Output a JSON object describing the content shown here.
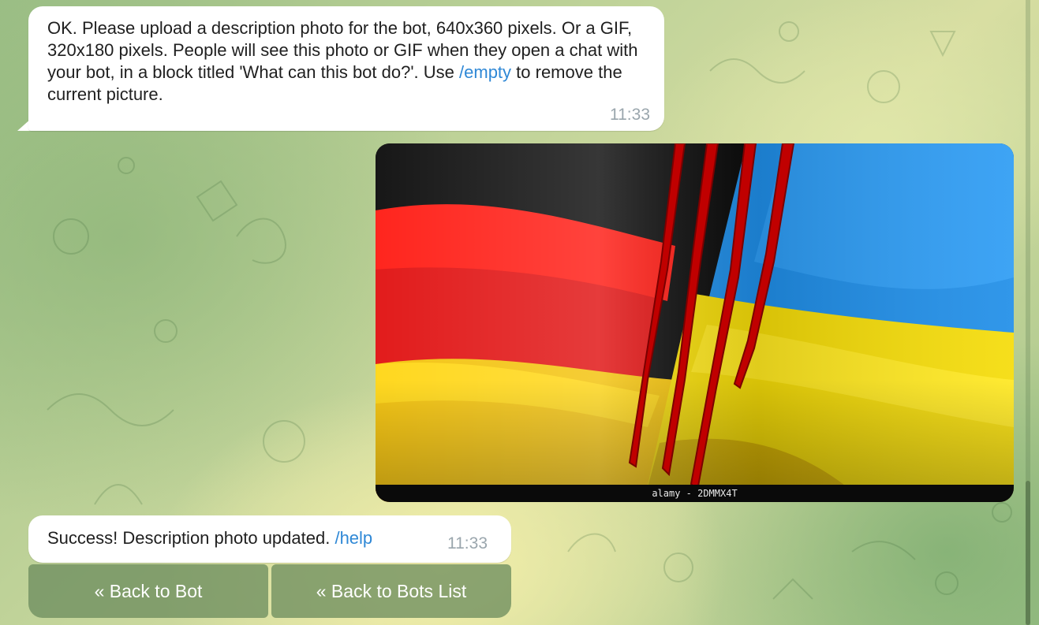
{
  "chat": {
    "messages": [
      {
        "type": "text",
        "direction": "incoming",
        "text_before": "OK. Please upload a description photo for the bot, 640x360 pixels. Or a GIF,  320x180 pixels. People will see this photo or GIF when they open a chat with your bot, in a block titled 'What can this bot do?'. Use ",
        "command": "/empty",
        "text_after": " to remove the current picture.",
        "time": "11:33"
      },
      {
        "type": "photo",
        "direction": "outgoing",
        "image_caption": "alamy - 2DMMX4T",
        "image_subject": "german-and-ukrainian-flags-torn"
      },
      {
        "type": "text",
        "direction": "incoming",
        "text_before": "Success! Description photo updated. ",
        "command": "/help",
        "time": "11:33"
      }
    ],
    "keyboard": [
      {
        "label": "« Back to Bot"
      },
      {
        "label": "« Back to Bots List"
      }
    ]
  },
  "colors": {
    "link": "#2f88d6",
    "bubble": "#ffffff",
    "time": "#9aa6ad",
    "keyboard_button": "#6e8e5f"
  }
}
